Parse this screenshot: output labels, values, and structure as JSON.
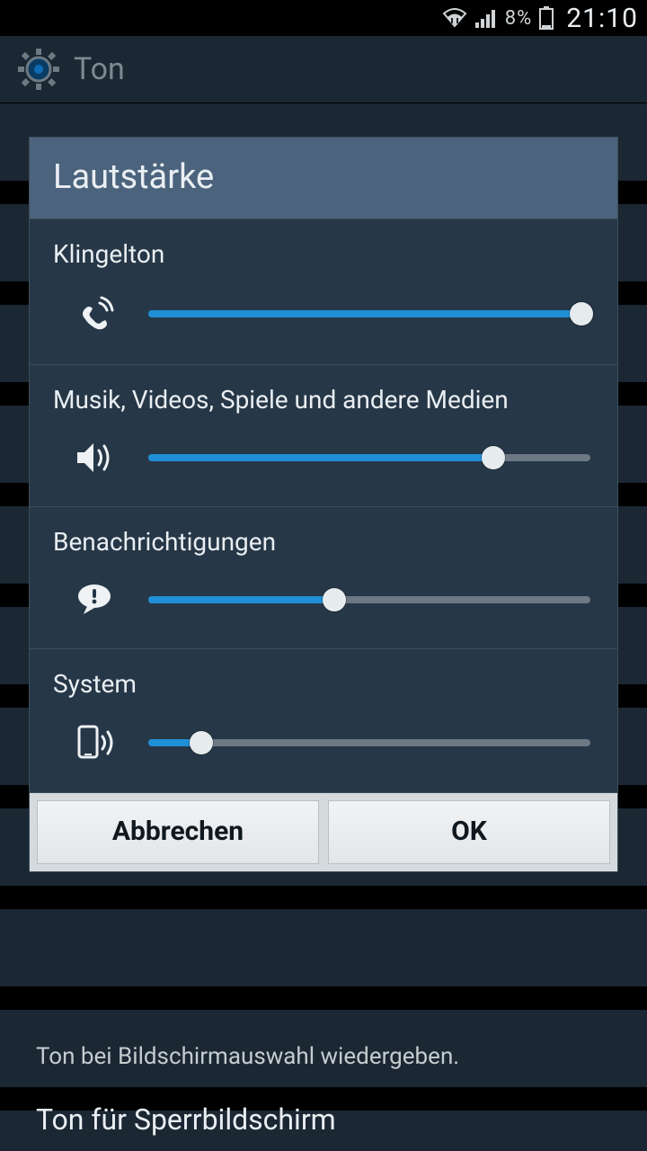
{
  "statusbar": {
    "battery_pct": "8%",
    "clock": "21:10"
  },
  "header": {
    "title": "Ton"
  },
  "background": {
    "row_touch_sound": "Ton bei Bildschirmauswahl wiedergeben.",
    "row_lockscreen_sound": "Ton für Sperrbildschirm"
  },
  "modal": {
    "title": "Lautstärke",
    "sections": [
      {
        "label": "Klingelton",
        "value_pct": 98,
        "icon": "ringer"
      },
      {
        "label": "Musik, Videos, Spiele und andere Medien",
        "value_pct": 78,
        "icon": "media"
      },
      {
        "label": "Benachrichtigungen",
        "value_pct": 42,
        "icon": "notification"
      },
      {
        "label": "System",
        "value_pct": 12,
        "icon": "system"
      }
    ],
    "cancel": "Abbrechen",
    "ok": "OK"
  }
}
